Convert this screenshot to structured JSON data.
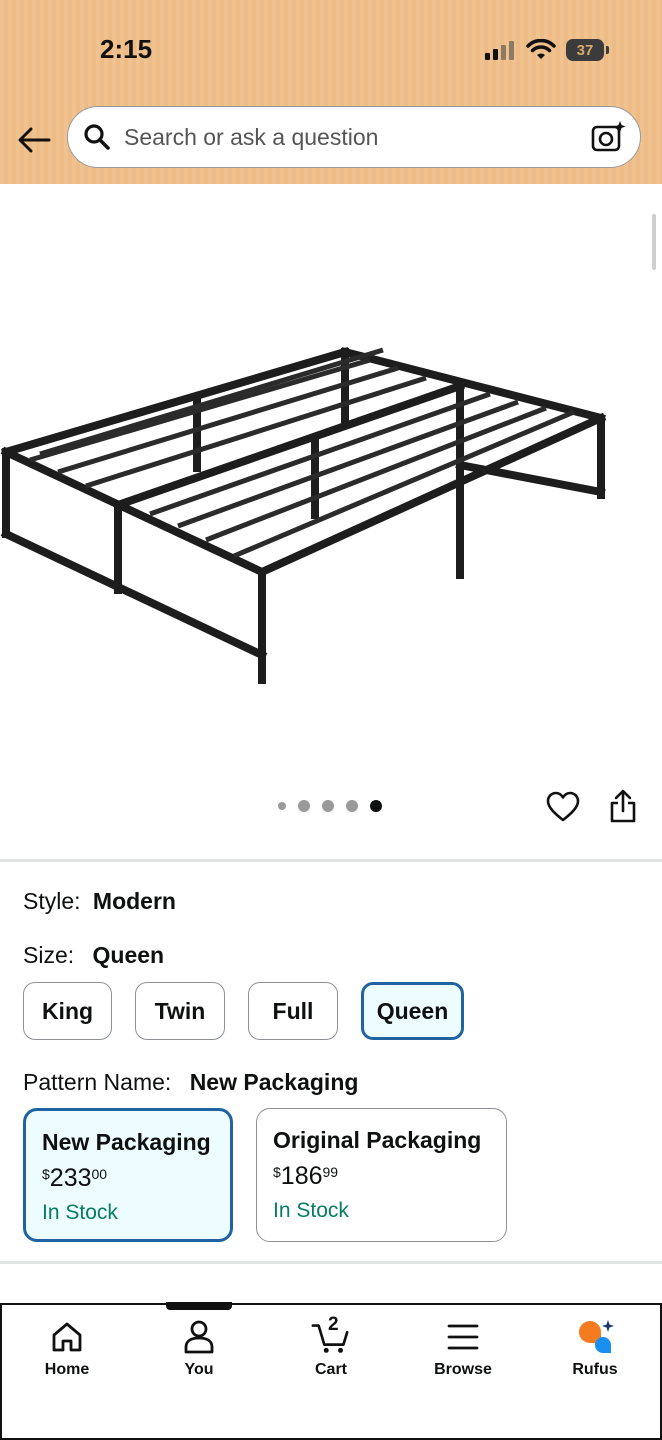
{
  "status_bar": {
    "time": "2:15",
    "battery": "37"
  },
  "search": {
    "placeholder": "Search or ask a question"
  },
  "carousel": {
    "total_images": 5,
    "active_index": 4
  },
  "variations": {
    "style_label": "Style:",
    "style_value": "Modern",
    "size_label": "Size:",
    "size_value": "Queen",
    "sizes": [
      "King",
      "Twin",
      "Full",
      "Queen"
    ],
    "selected_size": "Queen",
    "pattern_label": "Pattern Name:",
    "pattern_value": "New Packaging",
    "patterns": [
      {
        "name": "New Packaging",
        "currency": "$",
        "price_whole": "233",
        "price_cents": "00",
        "stock": "In Stock",
        "selected": true
      },
      {
        "name": "Original Packaging",
        "currency": "$",
        "price_whole": "186",
        "price_cents": "99",
        "stock": "In Stock",
        "selected": false
      }
    ]
  },
  "colors": {
    "accent_selected": "#2162a1",
    "in_stock": "#067d62",
    "rufus_orange": "#f47b20",
    "rufus_blue": "#1a8ff0"
  },
  "bottom_nav": {
    "items": [
      {
        "label": "Home",
        "icon": "home-icon"
      },
      {
        "label": "You",
        "icon": "user-icon"
      },
      {
        "label": "Cart",
        "icon": "cart-icon",
        "badge": "2"
      },
      {
        "label": "Browse",
        "icon": "menu-icon"
      },
      {
        "label": "Rufus",
        "icon": "rufus-icon"
      }
    ]
  }
}
